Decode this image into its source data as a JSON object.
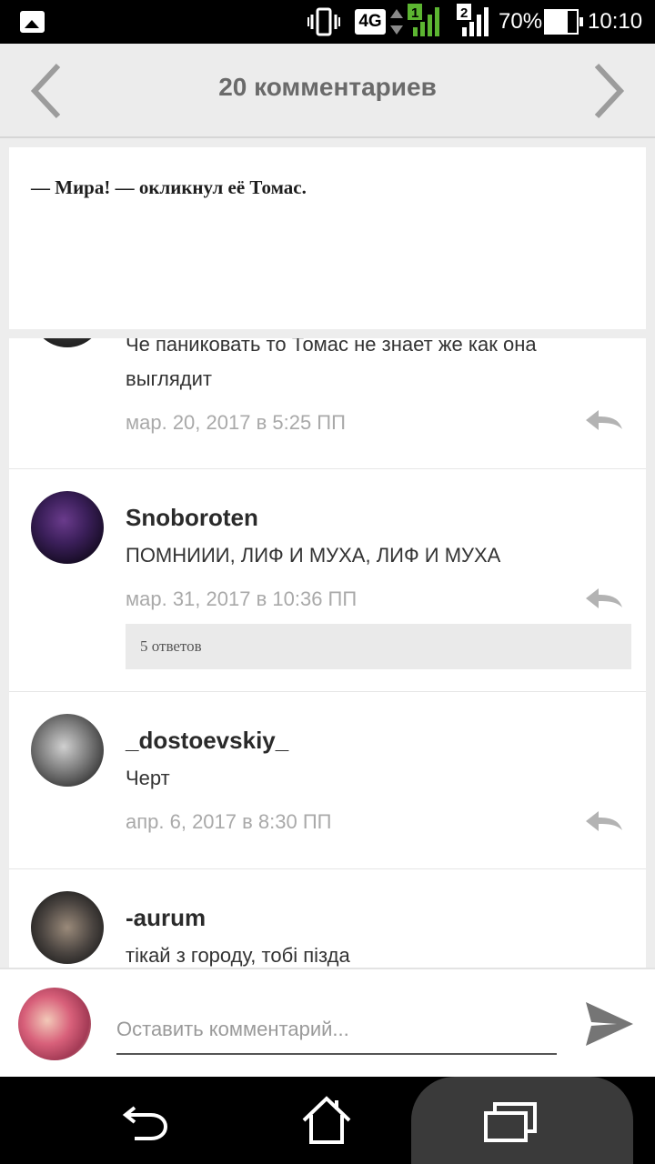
{
  "status_bar": {
    "network": "4G",
    "sim1": "1",
    "sim2": "2",
    "battery": "70%",
    "battery_level": 0.7,
    "time": "10:10"
  },
  "header": {
    "title": "20 комментариев"
  },
  "quote": {
    "text": "— Мира! — окликнул её Томас."
  },
  "comments": [
    {
      "author": "",
      "text": "Че паниковать то Томас не знает же как она выглядит",
      "date": "мар. 20, 2017 в 5:25 ПП"
    },
    {
      "author": "Snoboroten",
      "text": "ПОМНИИИ, ЛИФ И МУХА, ЛИФ И МУХА",
      "date": "мар. 31, 2017 в 10:36 ПП",
      "replies": "5 ответов"
    },
    {
      "author": "_dostoevskiy_",
      "text": "Черт",
      "date": "апр. 6, 2017 в 8:30 ПП"
    },
    {
      "author": "-aurum",
      "text": "тікай з городу, тобі пізда"
    }
  ],
  "composer": {
    "placeholder": "Оставить комментарий..."
  },
  "icons": {
    "status": [
      "image-icon",
      "vibrate-icon",
      "data-arrows-icon",
      "signal-icon",
      "battery-icon"
    ],
    "header": [
      "chevron-left-icon",
      "chevron-right-icon"
    ],
    "comment": "reply-icon",
    "composer": "send-icon",
    "navigation": [
      "back-icon",
      "home-icon",
      "recents-icon"
    ]
  },
  "colors": {
    "accent_signal": "#5cb531",
    "header_bg": "#ececec",
    "date_text": "#a9a9a9"
  }
}
